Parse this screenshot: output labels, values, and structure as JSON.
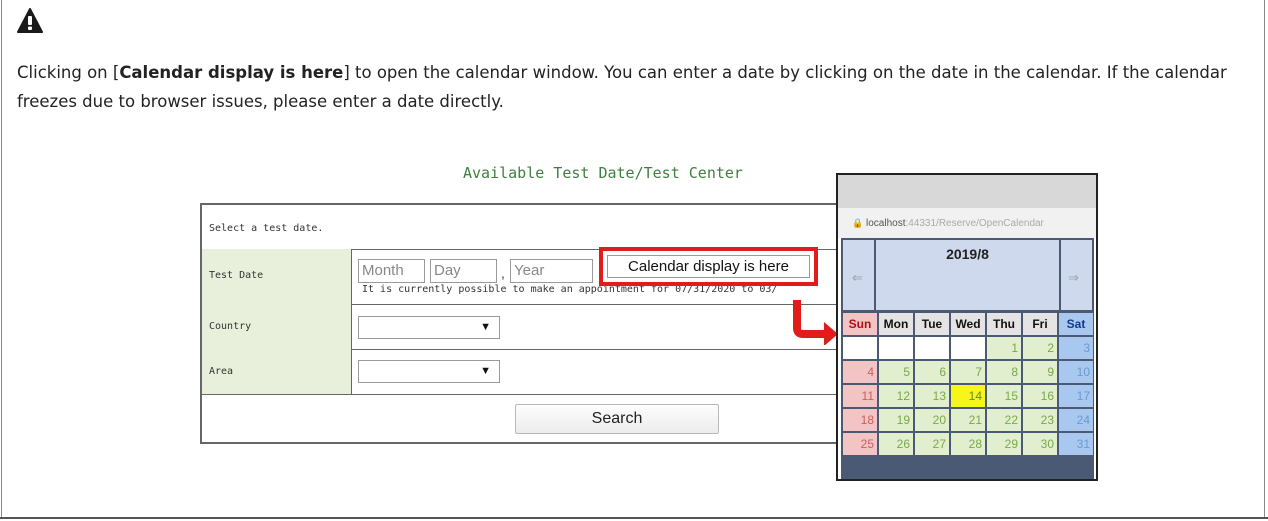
{
  "notice": {
    "text_before": "Clicking on [",
    "bold": "Calendar display is here",
    "text_after": "] to open the calendar window. You can enter a date by clicking on the date in the calendar. If the calendar freezes due to browser issues, please enter a date directly."
  },
  "form": {
    "title": "Available Test Date/Test Center",
    "select_prompt": "Select a test date.",
    "test_date_label": "Test Date",
    "month_placeholder": "Month",
    "day_placeholder": "Day",
    "year_placeholder": "Year",
    "separator": ",",
    "calendar_button": "Calendar display is here",
    "appointment_note": "It is currently possible to make an appointment for 07/31/2020 to 03/",
    "country_label": "Country",
    "area_label": "Area",
    "select_arrow": "▼",
    "search_button": "Search"
  },
  "calendar": {
    "url_prefix": "localhost",
    "url_rest": ":44331/Reserve/OpenCalendar",
    "month": "2019/8",
    "prev": "⇐",
    "next": "⇒",
    "weekdays": [
      "Sun",
      "Mon",
      "Tue",
      "Wed",
      "Thu",
      "Fri",
      "Sat"
    ],
    "weeks": [
      [
        "",
        "",
        "",
        "",
        "1",
        "2",
        "3"
      ],
      [
        "4",
        "5",
        "6",
        "7",
        "8",
        "9",
        "10"
      ],
      [
        "11",
        "12",
        "13",
        "14",
        "15",
        "16",
        "17"
      ],
      [
        "18",
        "19",
        "20",
        "21",
        "22",
        "23",
        "24"
      ],
      [
        "25",
        "26",
        "27",
        "28",
        "29",
        "30",
        "31"
      ]
    ],
    "highlight_day": "14"
  },
  "colors": {
    "accent_red": "#e21b1b",
    "label_green_bg": "#e8f0dc",
    "title_green": "#3f7f3f",
    "sun_bg": "#f2c4c4",
    "sat_bg": "#a9c8f0",
    "weekday_bg": "#e2efcf",
    "today_bg": "#f6f61a"
  }
}
